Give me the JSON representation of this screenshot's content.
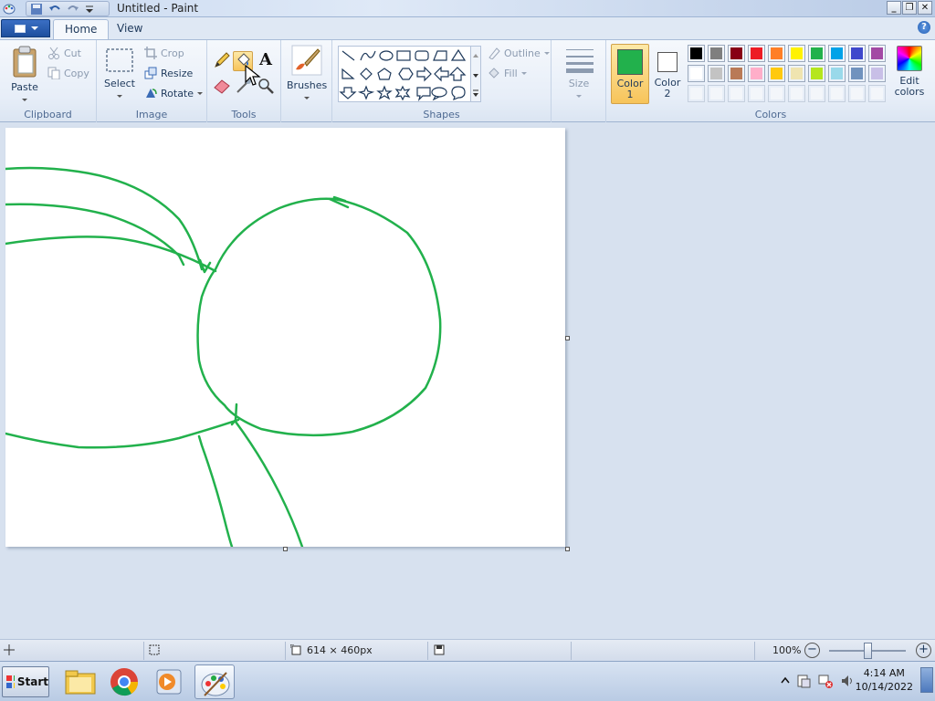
{
  "window": {
    "title": "Untitled - Paint"
  },
  "tabs": [
    {
      "label": "Home"
    },
    {
      "label": "View"
    }
  ],
  "clipboard": {
    "paste": "Paste",
    "cut": "Cut",
    "copy": "Copy",
    "group": "Clipboard"
  },
  "image": {
    "select": "Select",
    "crop": "Crop",
    "resize": "Resize",
    "rotate": "Rotate",
    "group": "Image"
  },
  "tools": {
    "group": "Tools",
    "text_tool": "A"
  },
  "brushes": {
    "label": "Brushes"
  },
  "shapes": {
    "outline": "Outline",
    "fill": "Fill",
    "group": "Shapes"
  },
  "size": {
    "label": "Size"
  },
  "colors": {
    "color1_label_a": "Color",
    "color1_label_b": "1",
    "color2_label_a": "Color",
    "color2_label_b": "2",
    "group": "Colors",
    "edit_a": "Edit",
    "edit_b": "colors",
    "color1": "#22b14c",
    "color2": "#ffffff",
    "palette_row1": [
      "#000000",
      "#7f7f7f",
      "#880015",
      "#ed1c24",
      "#ff7f27",
      "#fff200",
      "#22b14c",
      "#00a2e8",
      "#3f48cc",
      "#a349a4"
    ],
    "palette_row2": [
      "#ffffff",
      "#c3c3c3",
      "#b97a57",
      "#ffaec9",
      "#ffc90e",
      "#efe4b0",
      "#b5e61d",
      "#99d9ea",
      "#7092be",
      "#c8bfe7"
    ]
  },
  "status": {
    "dimensions": "614 × 460px",
    "zoom": "100%"
  },
  "taskbar": {
    "start": "Start",
    "time": "4:14 AM",
    "date": "10/14/2022"
  }
}
